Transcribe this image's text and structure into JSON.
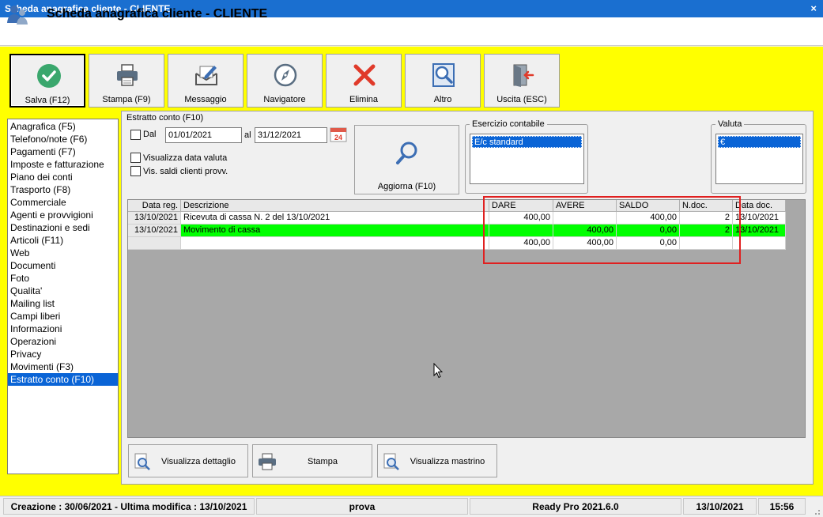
{
  "window": {
    "title": "Scheda anagrafica cliente - CLIENTE",
    "close": "×"
  },
  "header": {
    "title": "Scheda anagrafica cliente - CLIENTE",
    "icon": "customer-icon"
  },
  "toolbar": {
    "buttons": [
      {
        "label": "Salva (F12)",
        "icon": "check-icon"
      },
      {
        "label": "Stampa (F9)",
        "icon": "printer-icon"
      },
      {
        "label": "Messaggio",
        "icon": "message-icon"
      },
      {
        "label": "Navigatore",
        "icon": "compass-icon"
      },
      {
        "label": "Elimina",
        "icon": "delete-icon"
      },
      {
        "label": "Altro",
        "icon": "magnifier-book-icon"
      },
      {
        "label": "Uscita (ESC)",
        "icon": "exit-door-icon"
      }
    ]
  },
  "nav": {
    "items": [
      "Anagrafica (F5)",
      "Telefono/note (F6)",
      "Pagamenti (F7)",
      "Imposte e fatturazione",
      "Piano dei conti",
      "Trasporto (F8)",
      "Commerciale",
      "Agenti e provvigioni",
      "Destinazioni e sedi",
      "Articoli (F11)",
      "Web",
      "Documenti",
      "Foto",
      "Qualita'",
      "Mailing list",
      "Campi liberi",
      "Informazioni",
      "Operazioni",
      "Privacy",
      "Movimenti (F3)",
      "Estratto conto (F10)"
    ],
    "selected": "Estratto conto (F10)"
  },
  "filters": {
    "group_title": "Estratto conto (F10)",
    "dal_label": "Dal",
    "dal_value": "01/01/2021",
    "al_label": "al",
    "al_value": "31/12/2021",
    "calendar_day": "24",
    "check_data_valuta": "Visualizza data valuta",
    "check_saldi": "Vis. saldi clienti provv.",
    "refresh_label": "Aggiorna (F10)",
    "esercizio_label": "Esercizio contabile",
    "esercizio_selected": "E/c standard",
    "valuta_label": "Valuta",
    "valuta_selected": "€"
  },
  "grid": {
    "columns": [
      "Data reg.",
      "Descrizione",
      "DARE",
      "AVERE",
      "SALDO",
      "N.doc.",
      "Data doc."
    ],
    "rows": [
      {
        "data_reg": "13/10/2021",
        "descrizione": "Ricevuta di cassa N. 2 del 13/10/2021",
        "dare": "400,00",
        "avere": "",
        "saldo": "400,00",
        "ndoc": "2",
        "data_doc": "13/10/2021"
      },
      {
        "data_reg": "13/10/2021",
        "descrizione": "Movimento di cassa",
        "dare": "",
        "avere": "400,00",
        "saldo": "0,00",
        "ndoc": "2",
        "data_doc": "13/10/2021"
      }
    ],
    "totals": {
      "dare": "400,00",
      "avere": "400,00",
      "saldo": "0,00"
    }
  },
  "bottom_buttons": [
    {
      "label": "Visualizza dettaglio",
      "icon": "detail-magnifier-icon"
    },
    {
      "label": "Stampa",
      "icon": "printer-icon"
    },
    {
      "label": "Visualizza mastrino",
      "icon": "ledger-magnifier-icon"
    }
  ],
  "status": {
    "info": "Creazione : 30/06/2021 - Ultima modifica : 13/10/2021",
    "user": "prova",
    "version": "Ready Pro 2021.6.0",
    "date": "13/10/2021",
    "time": "15:56"
  }
}
